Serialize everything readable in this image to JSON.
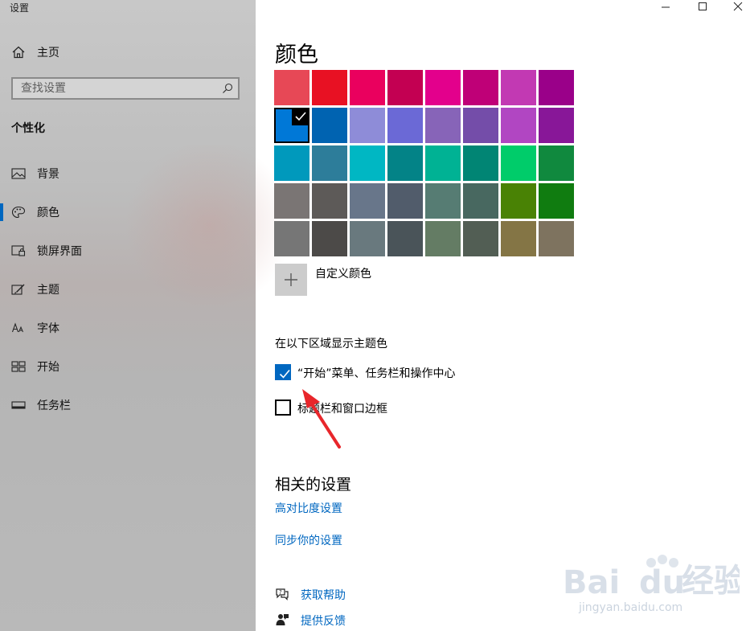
{
  "window": {
    "title": "设置"
  },
  "sidebar": {
    "home_label": "主页",
    "search_placeholder": "查找设置",
    "section_heading": "个性化",
    "items": [
      {
        "label": "背景",
        "icon": "image-icon"
      },
      {
        "label": "颜色",
        "icon": "palette-icon",
        "selected": true
      },
      {
        "label": "锁屏界面",
        "icon": "lock-screen-icon"
      },
      {
        "label": "主题",
        "icon": "theme-brush-icon"
      },
      {
        "label": "字体",
        "icon": "font-icon"
      },
      {
        "label": "开始",
        "icon": "start-tiles-icon"
      },
      {
        "label": "任务栏",
        "icon": "taskbar-icon"
      }
    ]
  },
  "main": {
    "title": "颜色",
    "palette": [
      "#e74856",
      "#e81123",
      "#ea005e",
      "#c30052",
      "#e3008c",
      "#bf0077",
      "#c239b3",
      "#9a0089",
      "#0078d7",
      "#0063b1",
      "#8e8cd8",
      "#6b69d6",
      "#8764b8",
      "#744da9",
      "#b146c2",
      "#881798",
      "#0099bc",
      "#2d7d9a",
      "#00b7c3",
      "#038387",
      "#00b294",
      "#018574",
      "#00cc6a",
      "#10893e",
      "#7a7574",
      "#5d5a58",
      "#68768a",
      "#515c6b",
      "#567c73",
      "#486860",
      "#498205",
      "#107c10",
      "#767676",
      "#4c4a48",
      "#69797e",
      "#4a5459",
      "#647c64",
      "#525e54",
      "#847545",
      "#7e735f"
    ],
    "selected_color": "#0078d7",
    "custom_color_label": "自定义颜色",
    "show_accent_heading": "在以下区域显示主题色",
    "checkbox_start": {
      "label": "“开始”菜单、任务栏和操作中心",
      "checked": true
    },
    "checkbox_title": {
      "label": "标题栏和窗口边框",
      "checked": false
    },
    "related_heading": "相关的设置",
    "related_links": [
      "高对比度设置",
      "同步你的设置"
    ],
    "help_links": [
      {
        "label": "获取帮助",
        "icon": "help-chat-icon"
      },
      {
        "label": "提供反馈",
        "icon": "feedback-icon"
      }
    ]
  },
  "colors": {
    "accent": "#0067c0",
    "annotation_arrow": "#e8262b"
  },
  "watermark": {
    "brand": "Baidu经验",
    "url": "jingyan.baidu.com"
  }
}
